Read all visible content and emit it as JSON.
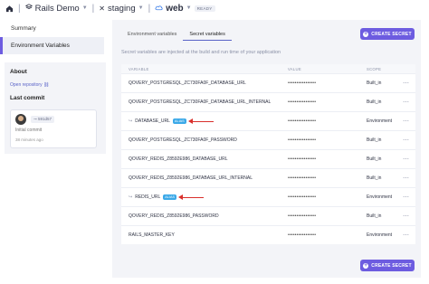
{
  "topbar": {
    "org": "Rails Demo",
    "environment": "staging",
    "service": "web",
    "service_status": "READY"
  },
  "sidebar": {
    "items": [
      {
        "label": "Summary"
      },
      {
        "label": "Environment Variables"
      }
    ]
  },
  "about": {
    "title": "About",
    "repo_link": "Open repository",
    "last_commit_title": "Last commit",
    "commit_hash": "591d57",
    "commit_message": "Initial commit",
    "commit_time": "38 minutes ago"
  },
  "main": {
    "tabs": [
      {
        "label": "Environment variables"
      },
      {
        "label": "Secret variables"
      }
    ],
    "create_button": "CREATE SECRET",
    "description": "Secret variables are injected at the build and run time of your application",
    "columns": {
      "variable": "VARIABLE",
      "value": "VALUE",
      "scope": "SCOPE"
    },
    "rows": [
      {
        "variable": "QOVERY_POSTGRESQL_ZC730FA0F_DATABASE_URL",
        "value": "••••••••••••••••",
        "scope": "Built_in",
        "alias": false
      },
      {
        "variable": "QOVERY_POSTGRESQL_ZC730FA0F_DATABASE_URL_INTERNAL",
        "value": "••••••••••••••••",
        "scope": "Built_in",
        "alias": false
      },
      {
        "variable": "DATABASE_URL",
        "value": "••••••••••••••••",
        "scope": "Environment",
        "alias": true,
        "alias_label": "ALIAS"
      },
      {
        "variable": "QOVERY_POSTGRESQL_ZC730FA0F_PASSWORD",
        "value": "••••••••••••••••",
        "scope": "Built_in",
        "alias": false
      },
      {
        "variable": "QOVERY_REDIS_Z8592E986_DATABASE_URL",
        "value": "••••••••••••••••",
        "scope": "Built_in",
        "alias": false
      },
      {
        "variable": "QOVERY_REDIS_Z8592E986_DATABASE_URL_INTERNAL",
        "value": "••••••••••••••••",
        "scope": "Built_in",
        "alias": false
      },
      {
        "variable": "REDIS_URL",
        "value": "••••••••••••••••",
        "scope": "Environment",
        "alias": true,
        "alias_label": "ALIAS"
      },
      {
        "variable": "QOVERY_REDIS_Z8592E986_PASSWORD",
        "value": "••••••••••••••••",
        "scope": "Built_in",
        "alias": false
      },
      {
        "variable": "RAILS_MASTER_KEY",
        "value": "••••••••••••••••",
        "scope": "Environment",
        "alias": false
      }
    ]
  },
  "colors": {
    "accent": "#6d5ce0",
    "alias_badge": "#3ba9e8",
    "annotation_arrow": "#d9302c"
  }
}
